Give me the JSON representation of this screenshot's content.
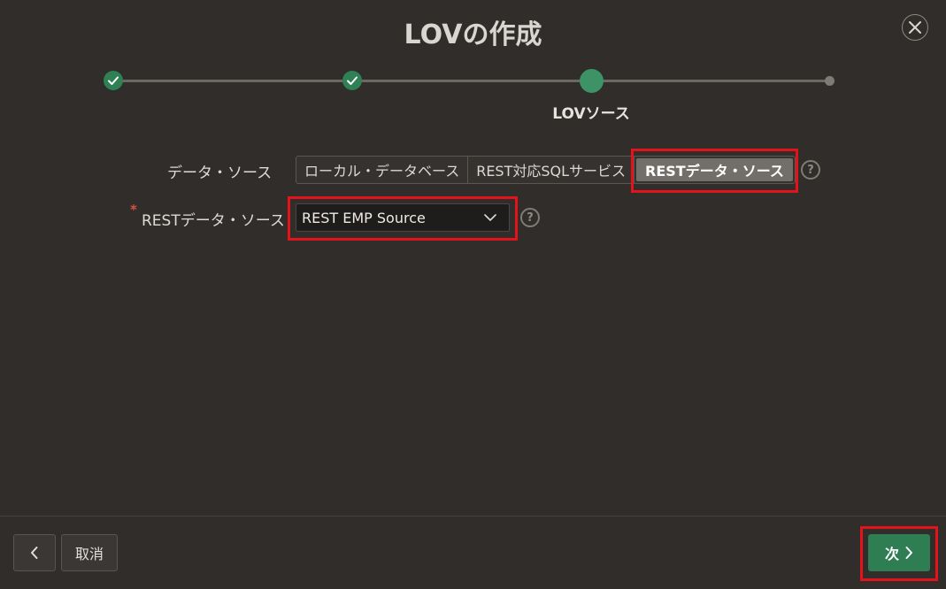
{
  "dialog": {
    "title": "LOVの作成"
  },
  "wizard": {
    "current_step_label": "LOVソース",
    "steps": [
      "done",
      "done",
      "current",
      "future"
    ]
  },
  "form": {
    "data_source": {
      "label": "データ・ソース",
      "options": [
        "ローカル・データベース",
        "REST対応SQLサービス",
        "RESTデータ・ソース"
      ],
      "selected": "RESTデータ・ソース"
    },
    "rest_source": {
      "required_mark": "*",
      "label": "RESTデータ・ソース",
      "value": "REST EMP Source"
    },
    "help_glyph": "?"
  },
  "footer": {
    "back_icon": "chevron-left-icon",
    "cancel_label": "取消",
    "next_label": "次"
  },
  "colors": {
    "background": "#302d2a",
    "accent_green": "#2f7d52",
    "highlight_red": "#e3121b"
  }
}
